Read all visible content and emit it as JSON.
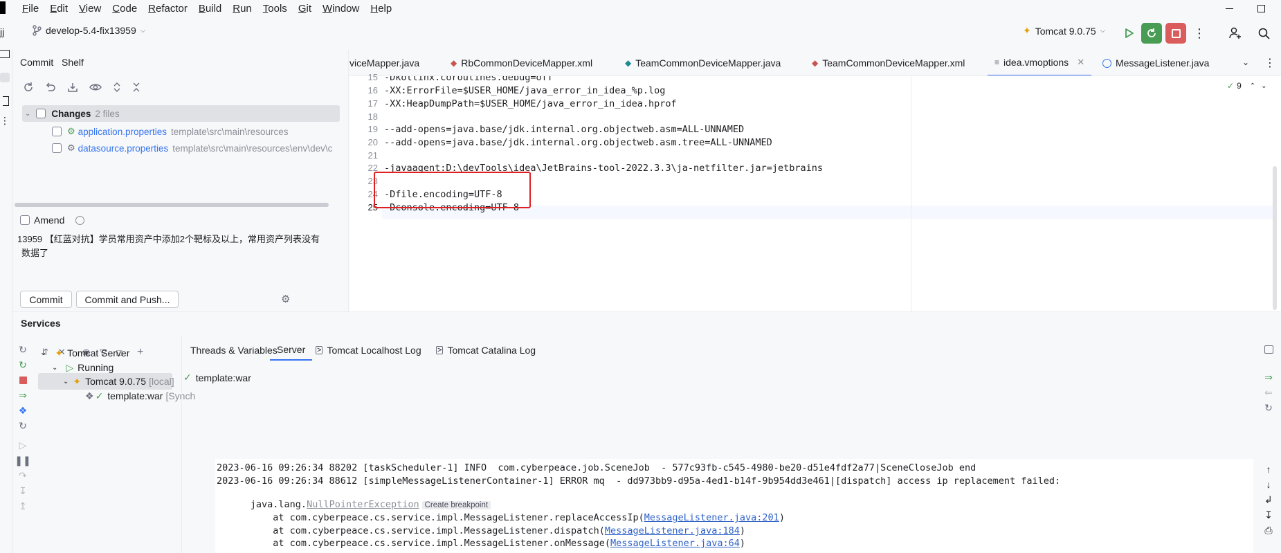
{
  "menubar": {
    "items": [
      "File",
      "Edit",
      "View",
      "Code",
      "Refactor",
      "Build",
      "Run",
      "Tools",
      "Git",
      "Window",
      "Help"
    ]
  },
  "toolbar": {
    "project_fragment": "jj",
    "branch": "develop-5.4-fix13959",
    "run_config": "Tomcat 9.0.75"
  },
  "commit_panel": {
    "tabs": [
      "Commit",
      "Shelf"
    ],
    "changes_label": "Changes",
    "changes_count": "2 files",
    "files": [
      {
        "name": "application.properties",
        "path": "template\\src\\main\\resources"
      },
      {
        "name": "datasource.properties",
        "path": "template\\src\\main\\resources\\env\\dev\\c"
      }
    ],
    "amend_label": "Amend",
    "message_line1": "13959 【红蓝对抗】学员常用资产中添加2个靶标及以上，常用资产列表没有",
    "message_line2": "数据了",
    "commit_button": "Commit",
    "commit_push_button": "Commit and Push..."
  },
  "editor": {
    "tabs": [
      {
        "label": "viceMapper.java",
        "active": false
      },
      {
        "label": "RbCommonDeviceMapper.xml",
        "active": false
      },
      {
        "label": "TeamCommonDeviceMapper.java",
        "active": false
      },
      {
        "label": "TeamCommonDeviceMapper.xml",
        "active": false
      },
      {
        "label": "idea.vmoptions",
        "active": true
      },
      {
        "label": "MessageListener.java",
        "active": false
      }
    ],
    "warnings_count": "9",
    "lines": [
      {
        "n": "15",
        "text": "-Dkotlinx.coroutines.debug=off"
      },
      {
        "n": "16",
        "text": "-XX:ErrorFile=$USER_HOME/java_error_in_idea_%p.log"
      },
      {
        "n": "17",
        "text": "-XX:HeapDumpPath=$USER_HOME/java_error_in_idea.hprof"
      },
      {
        "n": "18",
        "text": ""
      },
      {
        "n": "19",
        "text": "--add-opens=java.base/jdk.internal.org.objectweb.asm=ALL-UNNAMED"
      },
      {
        "n": "20",
        "text": "--add-opens=java.base/jdk.internal.org.objectweb.asm.tree=ALL-UNNAMED"
      },
      {
        "n": "21",
        "text": ""
      },
      {
        "n": "22",
        "text": "-javaagent:D:\\devTools\\idea\\JetBrains-tool-2022.3.3\\ja-netfilter.jar=jetbrains"
      },
      {
        "n": "23",
        "text": ""
      },
      {
        "n": "24",
        "text": "-Dfile.encoding=UTF-8"
      },
      {
        "n": "25",
        "text": "-Dconsole.encoding=UTF-8"
      }
    ]
  },
  "services": {
    "title": "Services",
    "tabs": [
      "Threads & Variables",
      "Server",
      "Tomcat Localhost Log",
      "Tomcat Catalina Log"
    ],
    "tree": {
      "server": "Tomcat Server",
      "state": "Running",
      "instance": "Tomcat 9.0.75",
      "instance_suffix": "[local]",
      "artifact": "template:war",
      "artifact_suffix": "[Synch"
    },
    "deploy_status": "template:war",
    "log": {
      "line1": "2023-06-16 09:26:34 88202 [taskScheduler-1] INFO  com.cyberpeace.job.SceneJob  - 577c93fb-c545-4980-be20-d51e4fdf2a77|SceneCloseJob end",
      "line2": "2023-06-16 09:26:34 88612 [simpleMessageListenerContainer-1] ERROR mq  - dd973bb9-d95a-4ed1-b14f-9b954dd3e461|[dispatch] access ip replacement failed:",
      "line3_prefix": "java.lang.",
      "line3_exception": "NullPointerException",
      "line3_hint": "Create breakpoint",
      "stack": [
        {
          "prefix": "    at com.cyberpeace.cs.service.impl.MessageListener.replaceAccessIp(",
          "link": "MessageListener.java:201",
          "suffix": ")"
        },
        {
          "prefix": "    at com.cyberpeace.cs.service.impl.MessageListener.dispatch(",
          "link": "MessageListener.java:184",
          "suffix": ")"
        },
        {
          "prefix": "    at com.cyberpeace.cs.service.impl.MessageListener.onMessage(",
          "link": "MessageListener.java:64",
          "suffix": ")"
        }
      ]
    }
  },
  "colors": {
    "accent": "#3574f0",
    "highlight_box": "#e02020",
    "run_green": "#499c54",
    "stop_red": "#db5c5c"
  }
}
